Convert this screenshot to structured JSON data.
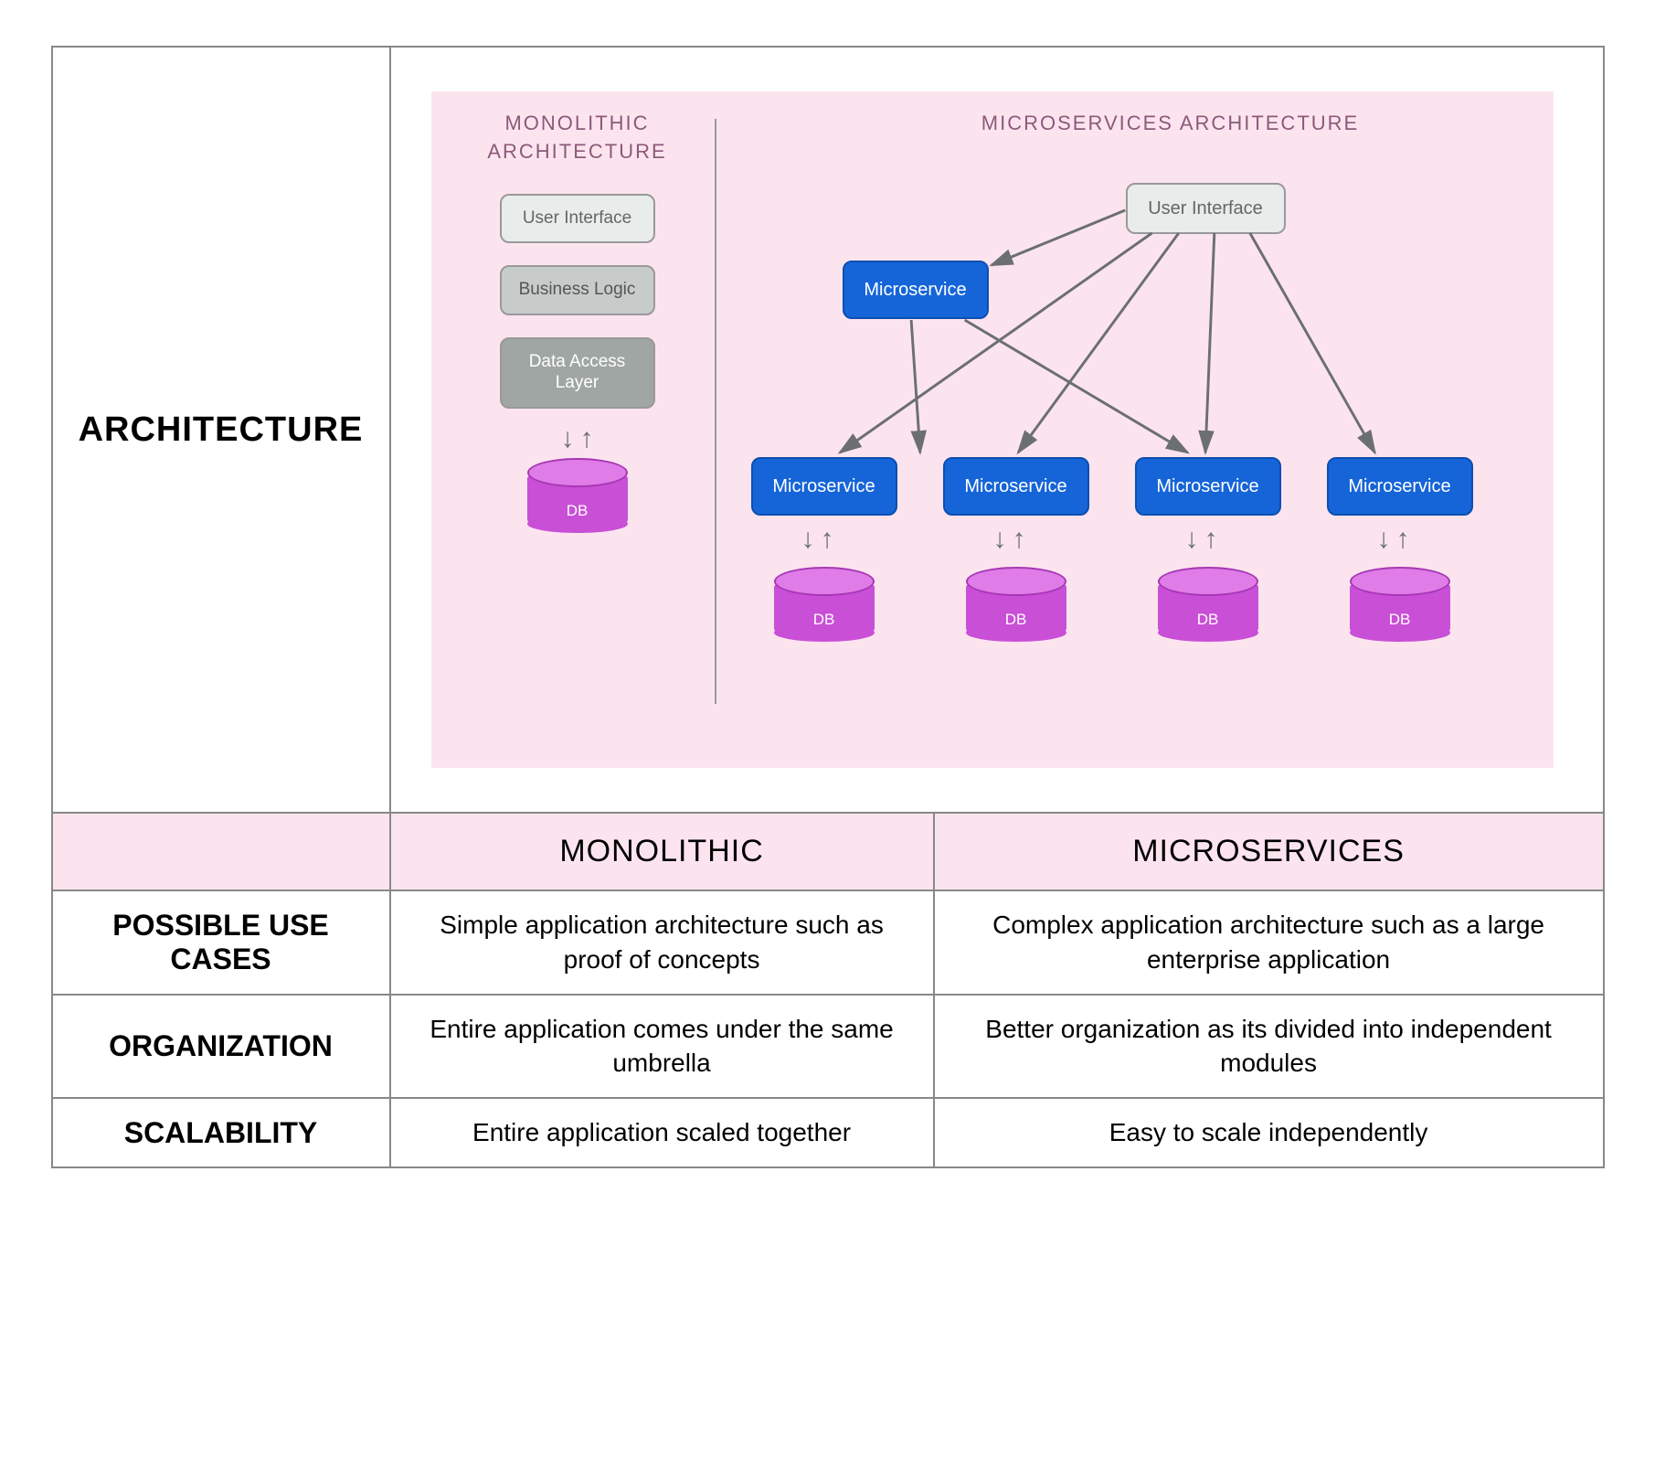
{
  "diagram": {
    "monolithic": {
      "title": "MONOLITHIC ARCHITECTURE",
      "layers": {
        "ui": "User Interface",
        "bl": "Business Logic",
        "dal": "Data Access Layer"
      },
      "db": "DB"
    },
    "microservices": {
      "title": "MICROSERVICES ARCHITECTURE",
      "ui": "User Interface",
      "service_label": "Microservice",
      "db": "DB"
    }
  },
  "table": {
    "arch_row_label": "ARCHITECTURE",
    "col_headers": {
      "mono": "MONOLITHIC",
      "micro": "MICROSERVICES"
    },
    "rows": [
      {
        "label": "POSSIBLE USE CASES",
        "mono": "Simple application architecture such as proof of concepts",
        "micro": "Complex application architecture such as a large enterprise application"
      },
      {
        "label": "ORGANIZATION",
        "mono": "Entire application comes under the same umbrella",
        "micro": "Better organization as its divided into independent modules"
      },
      {
        "label": "SCALABILITY",
        "mono": "Entire application scaled together",
        "micro": "Easy to scale independently"
      }
    ]
  }
}
